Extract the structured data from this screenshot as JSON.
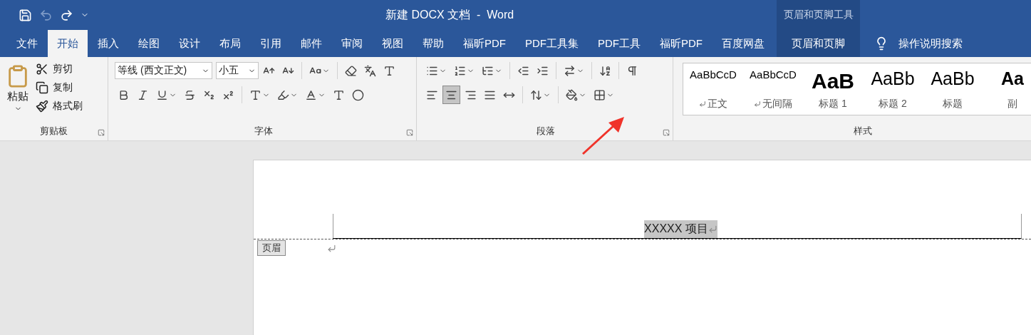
{
  "quick_access": [
    {
      "kind": "save",
      "disabled": false
    },
    {
      "kind": "undo",
      "disabled": true
    },
    {
      "kind": "redo",
      "disabled": false
    },
    {
      "kind": "customize",
      "disabled": false
    }
  ],
  "window": {
    "title": "新建 DOCX 文档  -  Word"
  },
  "contextual_group": {
    "title": "页眉和页脚工具"
  },
  "tabs": [
    {
      "label": "文件",
      "selected": false,
      "kind": "file"
    },
    {
      "label": "开始",
      "selected": true,
      "kind": "normal"
    },
    {
      "label": "插入",
      "selected": false,
      "kind": "normal"
    },
    {
      "label": "绘图",
      "selected": false,
      "kind": "normal"
    },
    {
      "label": "设计",
      "selected": false,
      "kind": "normal"
    },
    {
      "label": "布局",
      "selected": false,
      "kind": "normal"
    },
    {
      "label": "引用",
      "selected": false,
      "kind": "normal"
    },
    {
      "label": "邮件",
      "selected": false,
      "kind": "normal"
    },
    {
      "label": "审阅",
      "selected": false,
      "kind": "normal"
    },
    {
      "label": "视图",
      "selected": false,
      "kind": "normal"
    },
    {
      "label": "帮助",
      "selected": false,
      "kind": "normal"
    },
    {
      "label": "福昕PDF",
      "selected": false,
      "kind": "normal"
    },
    {
      "label": "PDF工具集",
      "selected": false,
      "kind": "normal"
    },
    {
      "label": "PDF工具",
      "selected": false,
      "kind": "normal"
    },
    {
      "label": "福昕PDF",
      "selected": false,
      "kind": "normal"
    },
    {
      "label": "百度网盘",
      "selected": false,
      "kind": "normal"
    },
    {
      "label": "页眉和页脚",
      "selected": false,
      "kind": "contextual"
    }
  ],
  "tell_me": {
    "label": "操作说明搜索"
  },
  "clipboard": {
    "label": "剪贴板",
    "paste": "粘贴",
    "actions": [
      {
        "kind": "cut",
        "label": "剪切"
      },
      {
        "kind": "copy",
        "label": "复制"
      },
      {
        "kind": "format_painter",
        "label": "格式刷"
      }
    ]
  },
  "font": {
    "label": "字体",
    "font_name": "等线 (西文正文)",
    "font_size": "小五"
  },
  "paragraph": {
    "label": "段落",
    "alignments": [
      {
        "kind": "left",
        "selected": false
      },
      {
        "kind": "center",
        "selected": true
      },
      {
        "kind": "right",
        "selected": false
      },
      {
        "kind": "justify",
        "selected": false
      },
      {
        "kind": "distributed",
        "selected": false
      }
    ]
  },
  "styles": {
    "label": "样式",
    "items": [
      {
        "preview": "AaBbCcD",
        "name": "正文",
        "kind": "paragraph"
      },
      {
        "preview": "AaBbCcD",
        "name": "无间隔",
        "kind": "paragraph"
      },
      {
        "preview": "AaB",
        "name": "标题 1",
        "kind": "heading1"
      },
      {
        "preview": "AaBb",
        "name": "标题 2",
        "kind": "heading2"
      },
      {
        "preview": "AaBb",
        "name": "标题",
        "kind": "title"
      },
      {
        "preview": "Aa",
        "name": "副",
        "kind": "subtitle"
      }
    ]
  },
  "document": {
    "header_text": "XXXXX 项目",
    "header_tag": "页眉"
  }
}
